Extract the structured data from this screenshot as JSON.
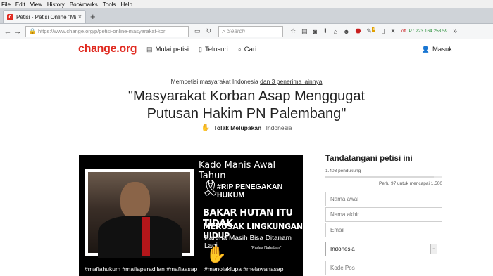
{
  "browser": {
    "menu": [
      "File",
      "Edit",
      "View",
      "History",
      "Bookmarks",
      "Tools",
      "Help"
    ],
    "tab_title": "Petisi - Petisi Online \"Masya...",
    "tab_close": "×",
    "newtab": "+",
    "url": "https://www.change.org/p/petisi-online-masyarakat-kor",
    "search_placeholder": "Search",
    "addon_badge": "3",
    "ip_prefix": "off",
    "ip_label": "IP : 223.164.253.59"
  },
  "site": {
    "logo": "change.org",
    "nav": [
      "Mulai petisi",
      "Telusuri",
      "Cari"
    ],
    "login": "Masuk"
  },
  "petition": {
    "target": "Mempetisi masyarakat Indonesia",
    "target_others": "dan 3 penerima lainnya",
    "title": "\"Masyarakat Korban Asap Menggugat Putusan Hakim PN Palembang\"",
    "author": "Tolak Melupakan",
    "location": "Indonesia",
    "image": {
      "heading": "Kado Manis Awal Tahun",
      "rip": "#RIP PENEGAKAN HUKUM",
      "line1": "BAKAR HUTAN ITU TIDAK",
      "line2": "MERUSAK LINGKUNGAN HIDUP",
      "line3": "Karena Masih Bisa Ditanam Lagi",
      "quote": "\"Parlas Nababan\"",
      "tags_left": "#mafiahukum #mafiaperadilan #mafiaasap",
      "tags_right": "#menolaklupa #melawanasap"
    }
  },
  "sign": {
    "heading": "Tandatangani petisi ini",
    "supporters": "1.403 pendukung",
    "progress": 0.93,
    "goal": "Perlu 97 untuk mencapai 1.500",
    "first_name": "Nama awal",
    "last_name": "Nama akhir",
    "email": "Email",
    "country": "Indonesia",
    "postal": "Kode Pos"
  }
}
